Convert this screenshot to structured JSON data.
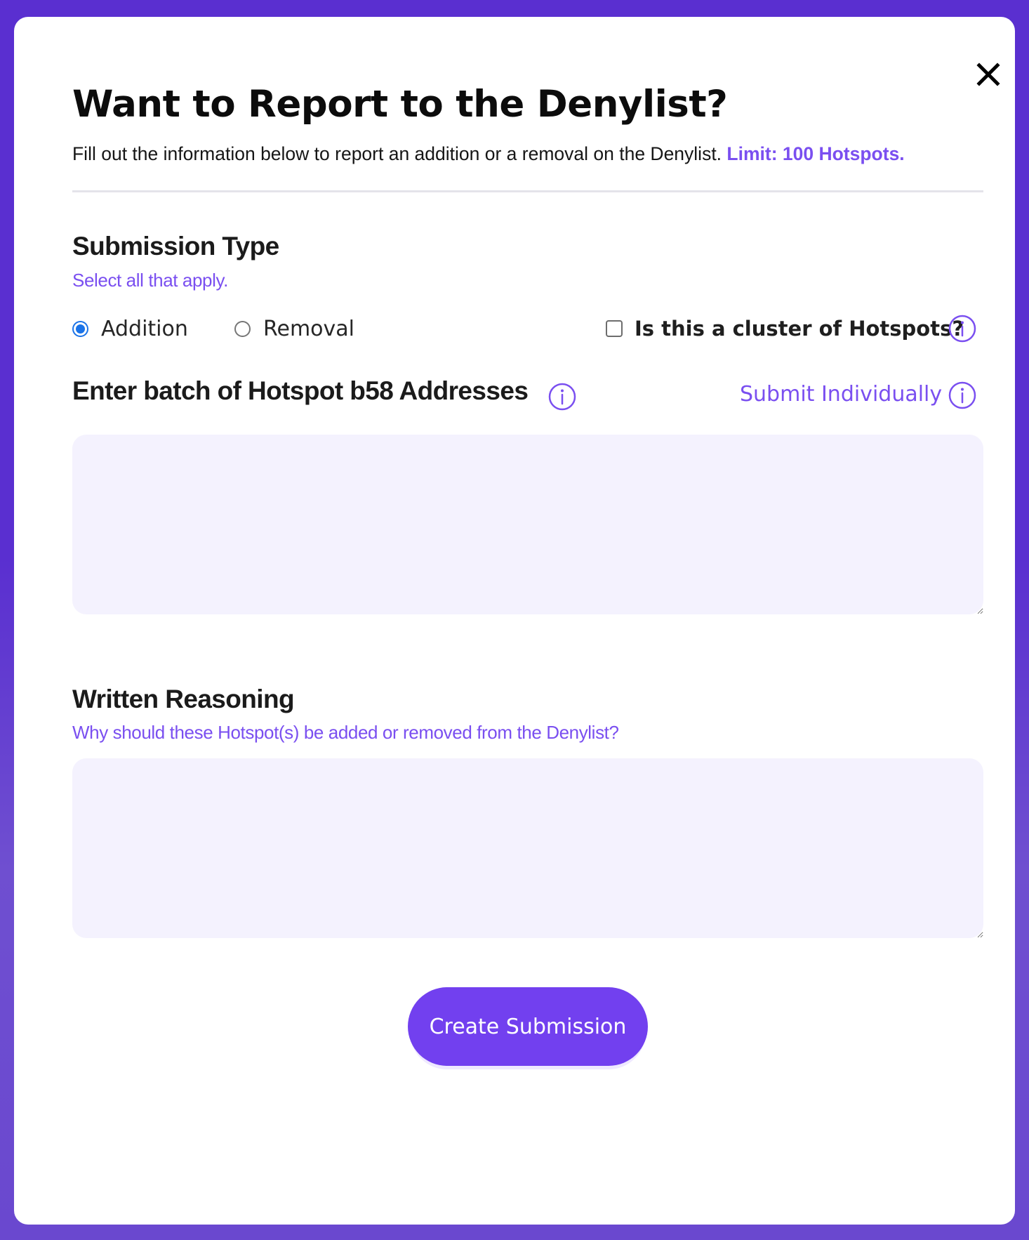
{
  "modal": {
    "title": "Want to Report to the Denylist?",
    "intro_text": "Fill out the information below to report an addition or a removal on the Denylist.",
    "limit_text": "Limit: 100 Hotspots.",
    "close_icon": "close-icon"
  },
  "submission_type": {
    "heading": "Submission Type",
    "helper": "Select all that apply.",
    "options": [
      {
        "label": "Addition",
        "selected": true
      },
      {
        "label": "Removal",
        "selected": false
      }
    ],
    "cluster_label": "Is this a cluster of Hotspots?",
    "cluster_checked": false,
    "info_icon": "info-icon"
  },
  "addresses": {
    "heading": "Enter batch of Hotspot b58 Addresses",
    "submit_individually": "Submit Individually",
    "value": ""
  },
  "reasoning": {
    "heading": "Written Reasoning",
    "helper": "Why should these Hotspot(s) be added or removed from the Denylist?",
    "value": ""
  },
  "actions": {
    "submit_label": "Create Submission"
  },
  "colors": {
    "accent": "#7240ef",
    "accent_text": "#7a4ff0",
    "field_bg": "#f4f2fe",
    "backdrop": "#5a2fd0",
    "radio_selected": "#1a73e8"
  }
}
